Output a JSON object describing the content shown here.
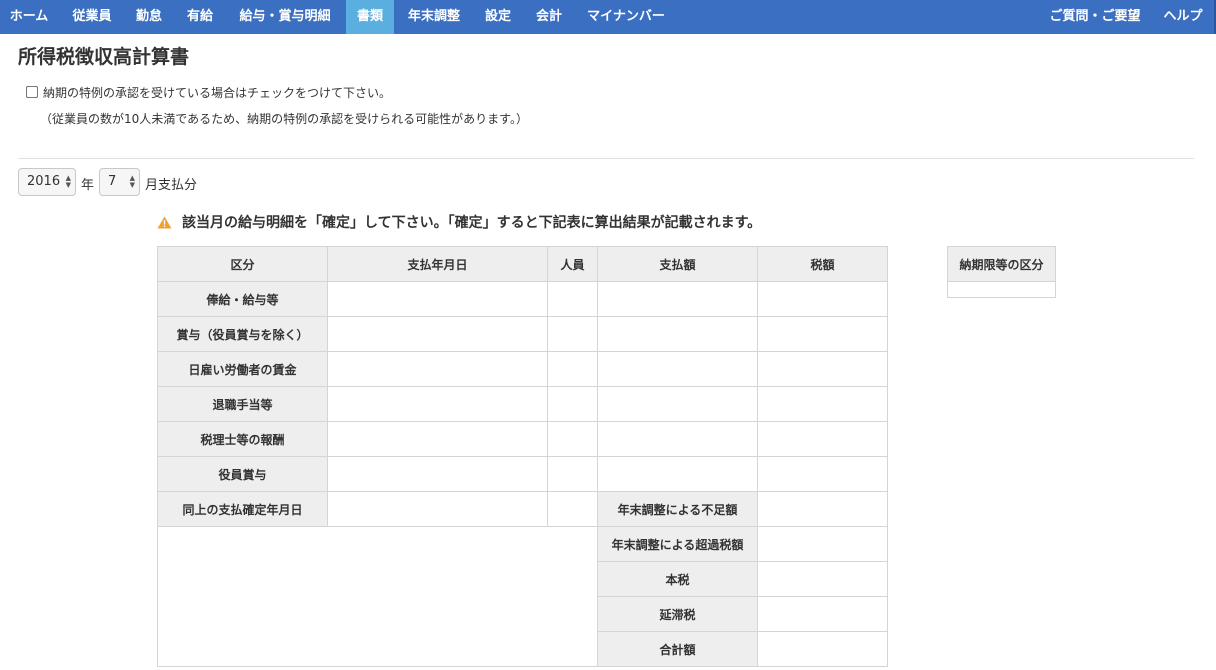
{
  "nav": {
    "items": [
      "ホーム",
      "従業員",
      "勤怠",
      "有給",
      "給与・賞与明細",
      "書類",
      "年末調整",
      "設定",
      "会計",
      "マイナンバー"
    ],
    "active_index": 5,
    "help_label": "ご質問・ご要望",
    "help2_label": "ヘルプ",
    "bar_color": "#3a6fc1",
    "active_color": "#5aaee0"
  },
  "page": {
    "title": "所得税徴収高計算書",
    "checkbox_label": "納期の特例の承認を受けている場合はチェックをつけて下さい。",
    "checkbox_checked": false,
    "note": "（従業員の数が10人未満であるため、納期の特例の承認を受けられる可能性があります。）"
  },
  "period": {
    "year": "2016",
    "year_suffix": "年",
    "month": "7",
    "month_suffix": "月支払分"
  },
  "warning": {
    "icon": "warning-triangle-icon",
    "text": "該当月の給与明細を「確定」して下さい。「確定」すると下記表に算出結果が記載されます。",
    "color": "#f0a030"
  },
  "table": {
    "headers": [
      "区分",
      "支払年月日",
      "人員",
      "支払額",
      "税額"
    ],
    "rows": [
      "俸給・給与等",
      "賞与（役員賞与を除く）",
      "日雇い労働者の賃金",
      "退職手当等",
      "税理士等の報酬",
      "役員賞与"
    ],
    "confirm_row_label": "同上の支払確定年月日",
    "summary_rows": [
      "年末調整による不足額",
      "年末調整による超過税額",
      "本税",
      "延滞税",
      "合計額"
    ]
  },
  "side_table": {
    "header": "納期限等の区分"
  }
}
